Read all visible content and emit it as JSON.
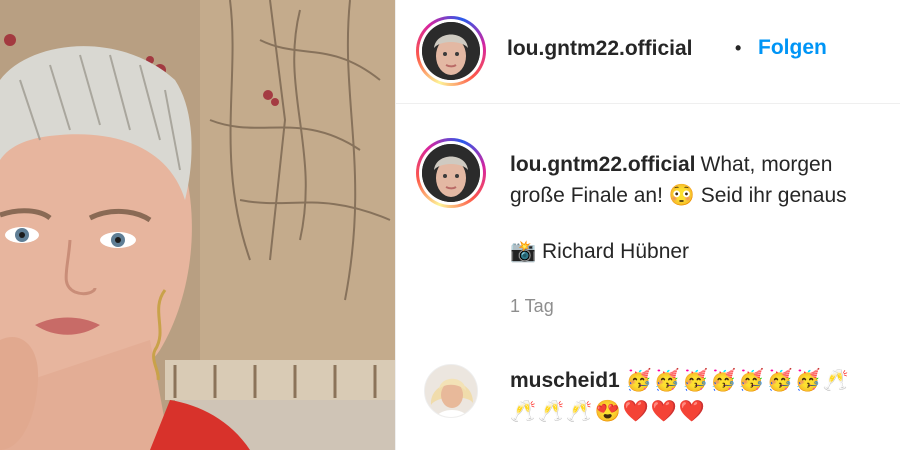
{
  "post": {
    "username": "lou.gntm22.official",
    "separator": "•",
    "follow_label": "Folgen"
  },
  "caption": {
    "username": "lou.gntm22.official",
    "line1": "What, morgen",
    "line2": "große Finale an! 😳 Seid ihr genaus",
    "credit": "📸 Richard Hübner",
    "time": "1 Tag"
  },
  "comment": {
    "username": "muscheid1",
    "line1_emojis": "🥳🥳🥳🥳🥳🥳🥳🥂",
    "line2_emojis": "🥂🥂🥂😍❤️❤️❤️"
  },
  "icons": {
    "post_photo": "portrait-photo",
    "avatar": "profile-avatar",
    "commenter_avatar": "commenter-avatar"
  },
  "colors": {
    "follow_blue": "#0095f6",
    "text": "#262626",
    "muted": "#8e8e8e",
    "divider": "#efefef"
  }
}
